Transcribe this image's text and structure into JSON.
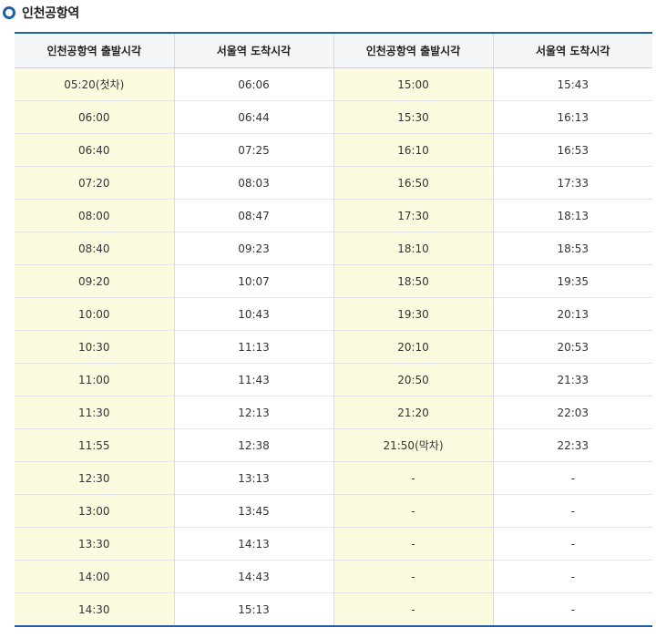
{
  "section": {
    "title": "인천공항역"
  },
  "table": {
    "headers": [
      "인천공항역 출발시각",
      "서울역 도착시각",
      "인천공항역 출발시각",
      "서울역 도착시각"
    ],
    "rows": [
      [
        "05:20(첫차)",
        "06:06",
        "15:00",
        "15:43"
      ],
      [
        "06:00",
        "06:44",
        "15:30",
        "16:13"
      ],
      [
        "06:40",
        "07:25",
        "16:10",
        "16:53"
      ],
      [
        "07:20",
        "08:03",
        "16:50",
        "17:33"
      ],
      [
        "08:00",
        "08:47",
        "17:30",
        "18:13"
      ],
      [
        "08:40",
        "09:23",
        "18:10",
        "18:53"
      ],
      [
        "09:20",
        "10:07",
        "18:50",
        "19:35"
      ],
      [
        "10:00",
        "10:43",
        "19:30",
        "20:13"
      ],
      [
        "10:30",
        "11:13",
        "20:10",
        "20:53"
      ],
      [
        "11:00",
        "11:43",
        "20:50",
        "21:33"
      ],
      [
        "11:30",
        "12:13",
        "21:20",
        "22:03"
      ],
      [
        "11:55",
        "12:38",
        "21:50(막차)",
        "22:33"
      ],
      [
        "12:30",
        "13:13",
        "-",
        "-"
      ],
      [
        "13:00",
        "13:45",
        "-",
        "-"
      ],
      [
        "13:30",
        "14:13",
        "-",
        "-"
      ],
      [
        "14:00",
        "14:43",
        "-",
        "-"
      ],
      [
        "14:30",
        "15:13",
        "-",
        "-"
      ]
    ]
  },
  "colors": {
    "accent": "#1f5fa8",
    "departure_cell_bg": "#fdfbdf",
    "header_bg": "#f4f5f7"
  }
}
